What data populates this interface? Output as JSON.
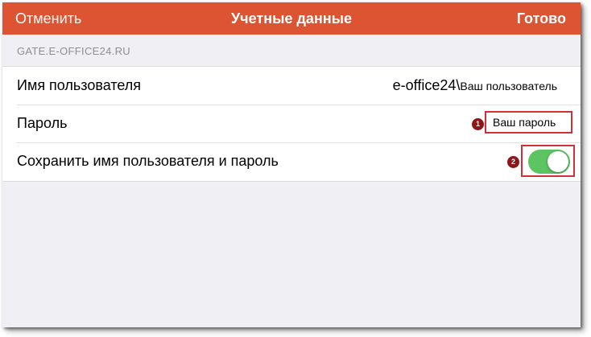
{
  "navbar": {
    "cancel_label": "Отменить",
    "title": "Учетные данные",
    "done_label": "Готово",
    "background_color": "#dd5433"
  },
  "section": {
    "header": "GATE.E-OFFICE24.RU"
  },
  "username_row": {
    "label": "Имя пользователя",
    "value_domain": "e-office24\\",
    "value_user": "Ваш пользователь"
  },
  "password_row": {
    "label": "Пароль",
    "value": "Ваш пароль",
    "marker": "1"
  },
  "save_row": {
    "label": "Сохранить имя пользователя и пароль",
    "toggle_on": true,
    "toggle_color": "#5cc460",
    "marker": "2"
  },
  "highlight_color": "#d0303a"
}
